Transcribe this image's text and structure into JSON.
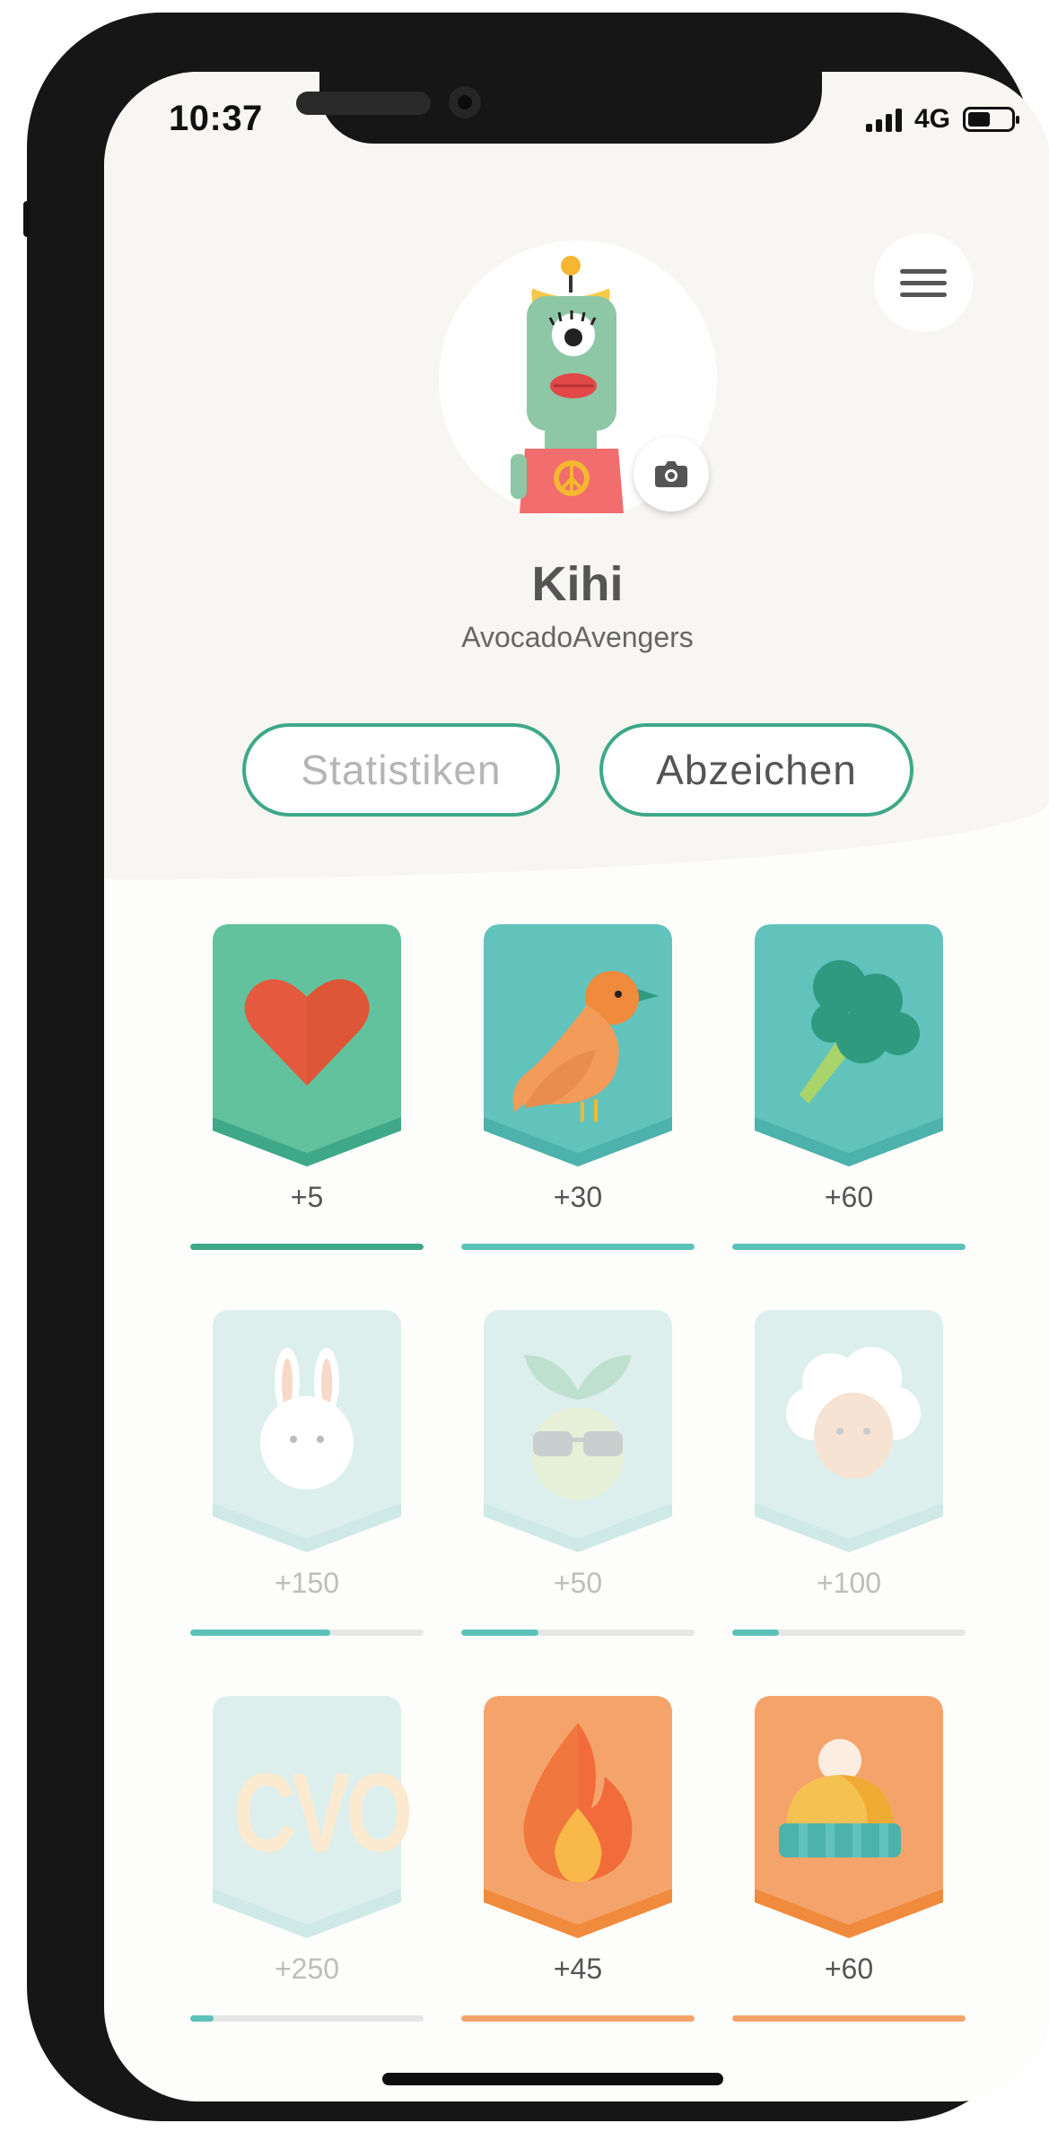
{
  "status_bar": {
    "time": "10:37",
    "network": "4G"
  },
  "profile": {
    "name": "Kihi",
    "team": "AvocadoAvengers"
  },
  "tabs": [
    {
      "label": "Statistiken",
      "active": false
    },
    {
      "label": "Abzeichen",
      "active": true
    }
  ],
  "badges": [
    {
      "icon": "heart-icon",
      "value": "+5",
      "progress": 1.0,
      "unlocked": true,
      "color": "#63c29e",
      "bar_color": "#3ea889"
    },
    {
      "icon": "bird-icon",
      "value": "+30",
      "progress": 1.0,
      "unlocked": true,
      "color": "#62c3bd",
      "bar_color": "#5cc1b9"
    },
    {
      "icon": "broccoli-icon",
      "value": "+60",
      "progress": 1.0,
      "unlocked": true,
      "color": "#62c3bd",
      "bar_color": "#5cc1b9"
    },
    {
      "icon": "rabbit-icon",
      "value": "+150",
      "progress": 0.6,
      "unlocked": false,
      "color": "#dcefed",
      "bar_color": "#5cc1b9"
    },
    {
      "icon": "kohlrabi-sunglasses-icon",
      "value": "+50",
      "progress": 0.33,
      "unlocked": false,
      "color": "#dcefed",
      "bar_color": "#5cc1b9"
    },
    {
      "icon": "sheep-icon",
      "value": "+100",
      "progress": 0.2,
      "unlocked": false,
      "color": "#dcefed",
      "bar_color": "#5cc1b9"
    },
    {
      "icon": "cvo-text-icon",
      "value": "+250",
      "progress": 0.1,
      "unlocked": false,
      "color": "#dcefed",
      "bar_color": "#5cc1b9",
      "icon_text": "CVO"
    },
    {
      "icon": "fire-icon",
      "value": "+45",
      "progress": 1.0,
      "unlocked": true,
      "color": "#f4a46b",
      "bar_color": "#f4a46b"
    },
    {
      "icon": "beanie-icon",
      "value": "+60",
      "progress": 1.0,
      "unlocked": true,
      "color": "#f4a46b",
      "bar_color": "#f4a46b"
    }
  ]
}
